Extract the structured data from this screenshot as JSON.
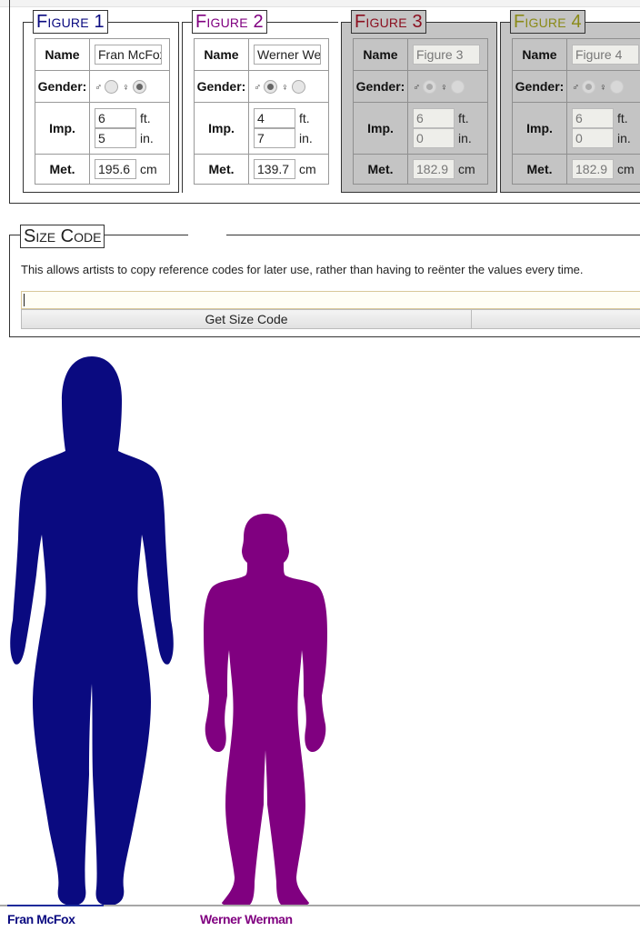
{
  "figures": [
    {
      "legend": "Figure 1",
      "color": "#0a0a80",
      "enabled": true,
      "labels": {
        "name": "Name",
        "gender": "Gender:",
        "imp": "Imp.",
        "met": "Met."
      },
      "name": "Fran McFox",
      "gender_selected": "female",
      "male_symbol": "♂",
      "female_symbol": "♀",
      "feet": "6",
      "inches": "5",
      "ft_unit": "ft.",
      "in_unit": "in.",
      "cm": "195.6",
      "cm_unit": "cm"
    },
    {
      "legend": "Figure 2",
      "color": "#800080",
      "enabled": true,
      "labels": {
        "name": "Name",
        "gender": "Gender:",
        "imp": "Imp.",
        "met": "Met."
      },
      "name": "Werner Wer",
      "gender_selected": "male",
      "male_symbol": "♂",
      "female_symbol": "♀",
      "feet": "4",
      "inches": "7",
      "ft_unit": "ft.",
      "in_unit": "in.",
      "cm": "139.7",
      "cm_unit": "cm"
    },
    {
      "legend": "Figure 3",
      "color": "#8b1020",
      "enabled": false,
      "labels": {
        "name": "Name",
        "gender": "Gender:",
        "imp": "Imp.",
        "met": "Met."
      },
      "name": "Figure 3",
      "gender_selected": "male",
      "male_symbol": "♂",
      "female_symbol": "♀",
      "feet": "6",
      "inches": "0",
      "ft_unit": "ft.",
      "in_unit": "in.",
      "cm": "182.9",
      "cm_unit": "cm"
    },
    {
      "legend": "Figure 4",
      "color": "#8a8a18",
      "enabled": false,
      "labels": {
        "name": "Name",
        "gender": "Gender:",
        "imp": "Imp.",
        "met": "Met."
      },
      "name": "Figure 4",
      "gender_selected": "male",
      "male_symbol": "♂",
      "female_symbol": "♀",
      "feet": "6",
      "inches": "0",
      "ft_unit": "ft.",
      "in_unit": "in.",
      "cm": "182.9",
      "cm_unit": "cm"
    }
  ],
  "size_code": {
    "legend": "Size Code",
    "description": "This allows artists to copy reference codes for later use, rather than having to reënter the values every time.",
    "input_value": "",
    "get_button": "Get Size Code",
    "second_button": ""
  },
  "lineup": [
    {
      "label": "Fran McFox",
      "height_cm": 195.6,
      "gender": "female",
      "color": "#0a0a80"
    },
    {
      "label": "Werner Werman",
      "height_cm": 139.7,
      "gender": "male",
      "color": "#800080"
    }
  ]
}
